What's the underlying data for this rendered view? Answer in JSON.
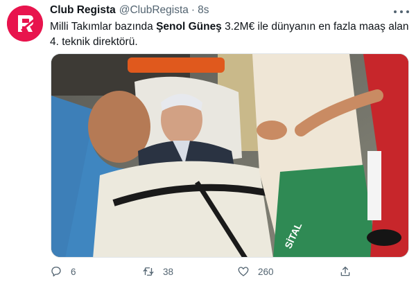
{
  "author": {
    "display_name": "Club Regista",
    "handle": "@ClubRegista",
    "separator": "·",
    "time": "8s",
    "avatar_icon": "club-regista-logo",
    "avatar_color": "#e8144d"
  },
  "tweet": {
    "text_before": "Milli Takımlar bazında ",
    "text_bold": "Şenol Güneş",
    "text_after": " 3.2M€ ile dünyanın en fazla maaş alan 4. teknik direktörü."
  },
  "media": {
    "overlay_text": "SİTAL"
  },
  "actions": {
    "reply": {
      "icon": "reply-icon",
      "count": "6"
    },
    "retweet": {
      "icon": "retweet-icon",
      "count": "38"
    },
    "like": {
      "icon": "heart-icon",
      "count": "260"
    },
    "share": {
      "icon": "share-icon"
    }
  },
  "colors": {
    "text": "#0f1419",
    "secondary": "#536471",
    "brand": "#e8144d"
  }
}
